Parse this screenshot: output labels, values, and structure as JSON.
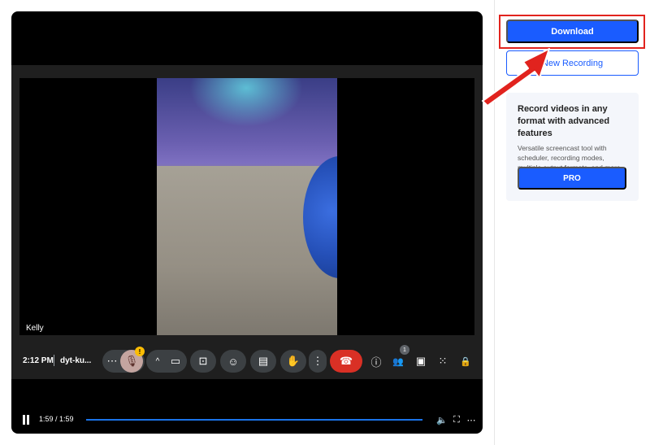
{
  "player": {
    "participant_name": "Kelly",
    "clock": "2:12 PM",
    "meeting_code": "dyt-ku...",
    "mic_warning": "!",
    "people_count": "1",
    "time_display": "1:59 / 1:59",
    "progress": 1.0
  },
  "icons": {
    "more_options": "⋯",
    "mic": "🎙",
    "chevron_up": "^",
    "camera": "▭",
    "present": "⊡",
    "emoji": "☺",
    "captions": "▤",
    "raise_hand": "✋",
    "more_vert": "⋮",
    "end_call": "☎",
    "info": "ⓘ",
    "people": "👥",
    "chat": "▣",
    "activities": "⁙",
    "host_controls": "🔒",
    "volume": "🔈",
    "fullscreen": "⛶",
    "player_more": "⋯"
  },
  "sidebar": {
    "download_label": "Download",
    "new_recording_label": "New Recording",
    "promo_title": "Record videos in any format with advanced features",
    "promo_text": "Versatile screencast tool with scheduler, recording modes, multiple output formats, and more.",
    "pro_label": "PRO"
  },
  "colors": {
    "accent": "#1a5cff",
    "highlight": "#e1231e",
    "end_call": "#d93025"
  }
}
